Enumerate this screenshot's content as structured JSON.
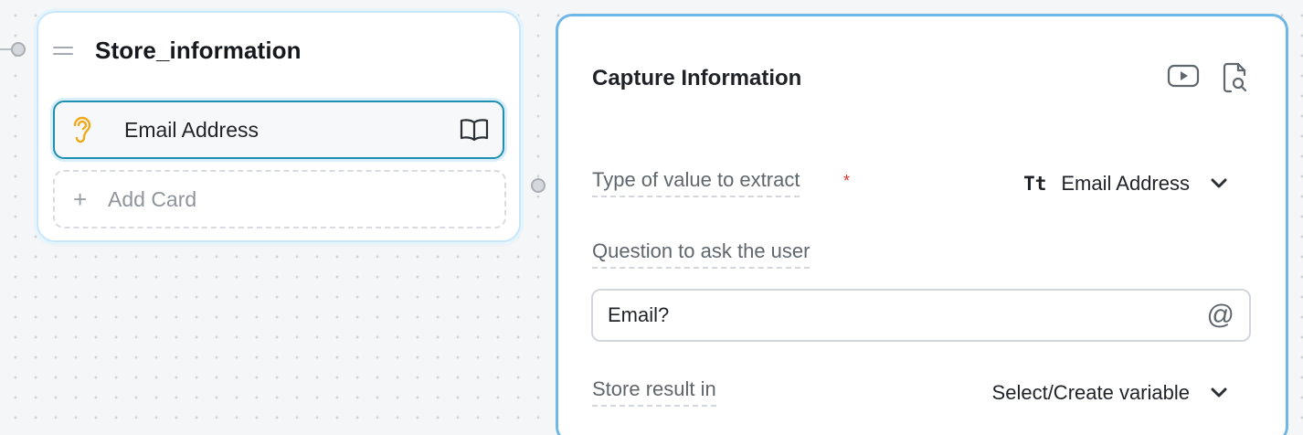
{
  "block": {
    "title": "Store_information",
    "card_label": "Email Address",
    "add_card_label": "Add Card"
  },
  "panel": {
    "title": "Capture Information",
    "icons": [
      "video-play-icon",
      "search-document-icon"
    ],
    "fields": {
      "type_label": "Type of value to extract",
      "required_mark": "*",
      "type_icon": "Tt",
      "type_value": "Email Address",
      "question_label": "Question to ask the user",
      "question_value": "Email?",
      "mention_symbol": "@",
      "store_label": "Store result in",
      "store_value": "Select/Create variable"
    }
  },
  "colors": {
    "accent": "#1f8fb2",
    "panel_border": "#6fb7e6",
    "required": "#d9342b",
    "ear_icon": "#f0a81c"
  }
}
